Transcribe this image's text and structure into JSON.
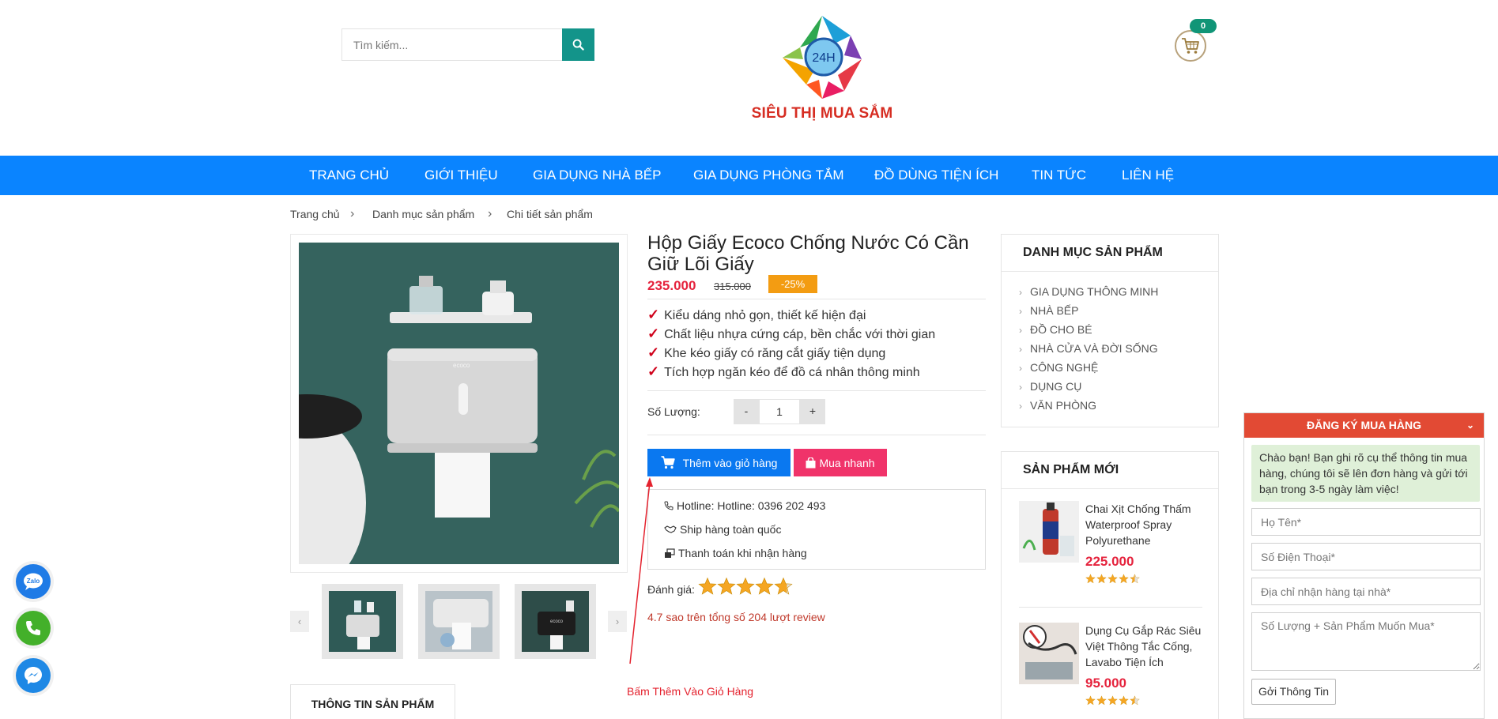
{
  "search": {
    "placeholder": "Tìm kiếm..."
  },
  "logo": {
    "badge": "24H",
    "text": "SIÊU THỊ MUA SẮM"
  },
  "cart": {
    "count": "0"
  },
  "nav": {
    "items": [
      {
        "label": "TRANG CHỦ"
      },
      {
        "label": "GIỚI THIỆU"
      },
      {
        "label": "GIA DỤNG NHÀ BẾP"
      },
      {
        "label": "GIA DỤNG PHÒNG TẮM"
      },
      {
        "label": "ĐỒ DÙNG TIỆN ÍCH"
      },
      {
        "label": "TIN TỨC"
      },
      {
        "label": "LIÊN HỆ"
      }
    ]
  },
  "breadcrumb": {
    "items": [
      "Trang chủ",
      "Danh mục sản phẩm",
      "Chi tiết sản phẩm"
    ],
    "separator": "›"
  },
  "gallery": {
    "prev": "‹",
    "next": "›",
    "thumb_logo": "ecoco"
  },
  "product": {
    "title": "Hộp Giấy Ecoco Chống Nước Có Cần Giữ Lõi Giấy",
    "price": "235.000",
    "old_price": "315.000",
    "discount": "-25%",
    "features": [
      "Kiểu dáng nhỏ gọn, thiết kế hiện đại",
      "Chất liệu nhựa cứng cáp, bền chắc với thời gian",
      "Khe kéo giấy có răng cắt giấy tiện dụng",
      "Tích hợp ngăn kéo để đồ cá nhân thông minh"
    ],
    "feature_mark": "✓",
    "qty_label": "Số Lượng:",
    "qty_minus": "-",
    "qty_value": "1",
    "qty_plus": "+",
    "add_to_cart": "Thêm vào giỏ hàng",
    "buy_now": "Mua nhanh",
    "info": {
      "hotline": "Hotline: Hotline: 0396 202 493",
      "shipping": "Ship hàng toàn quốc",
      "payment": "Thanh toán khi nhận hàng"
    },
    "rating_label": "Đánh giá:",
    "rating_value": 4.7,
    "rating_text": "4.7 sao trên tổng số 204 lượt review",
    "annotation": "Bấm Thêm Vào Giỏ Hàng"
  },
  "tabs": {
    "info": "THÔNG TIN SẢN PHẨM"
  },
  "sidebar": {
    "categories_title": "DANH MỤC SẢN PHẨM",
    "categories": [
      "GIA DỤNG THÔNG MINH",
      "NHÀ BẾP",
      "ĐỒ CHO BÉ",
      "NHÀ CỬA VÀ ĐỜI SỐNG",
      "CÔNG NGHỆ",
      "DỤNG CỤ",
      "VĂN PHÒNG"
    ],
    "chevron": "›",
    "new_title": "SẢN PHẨM MỚI",
    "new_products": [
      {
        "name": "Chai Xịt Chống Thấm Waterproof Spray Polyurethane",
        "price": "225.000",
        "rating": 4.5
      },
      {
        "name": "Dụng Cụ Gắp Rác Siêu Việt Thông Tắc Cống, Lavabo Tiện Ích",
        "price": "95.000",
        "rating": 4.5
      }
    ]
  },
  "register": {
    "title": "ĐĂNG KÝ MUA HÀNG",
    "chevron": "⌄",
    "message": "Chào bạn! Bạn ghi rõ cụ thể thông tin mua hàng, chúng tôi sẽ lên đơn hàng và gửi tới bạn trong 3-5 ngày làm việc!",
    "name_placeholder": "Họ Tên*",
    "phone_placeholder": "Số Điện Thoại*",
    "address_placeholder": "Địa chỉ nhận hàng tại nhà*",
    "note_placeholder": "Số Lượng + Sản Phẩm Muốn Mua*",
    "submit": "Gởi Thông Tin"
  },
  "floating": {
    "zalo_label": "Zalo"
  },
  "colors": {
    "nav": "#0a84ff",
    "accent": "#13948a",
    "price": "#e5233d",
    "discount": "#f39c12",
    "cart_button": "#0a78f0",
    "buy_button": "#f0336a",
    "register_header": "#e24a34",
    "star": "#f5a623"
  }
}
